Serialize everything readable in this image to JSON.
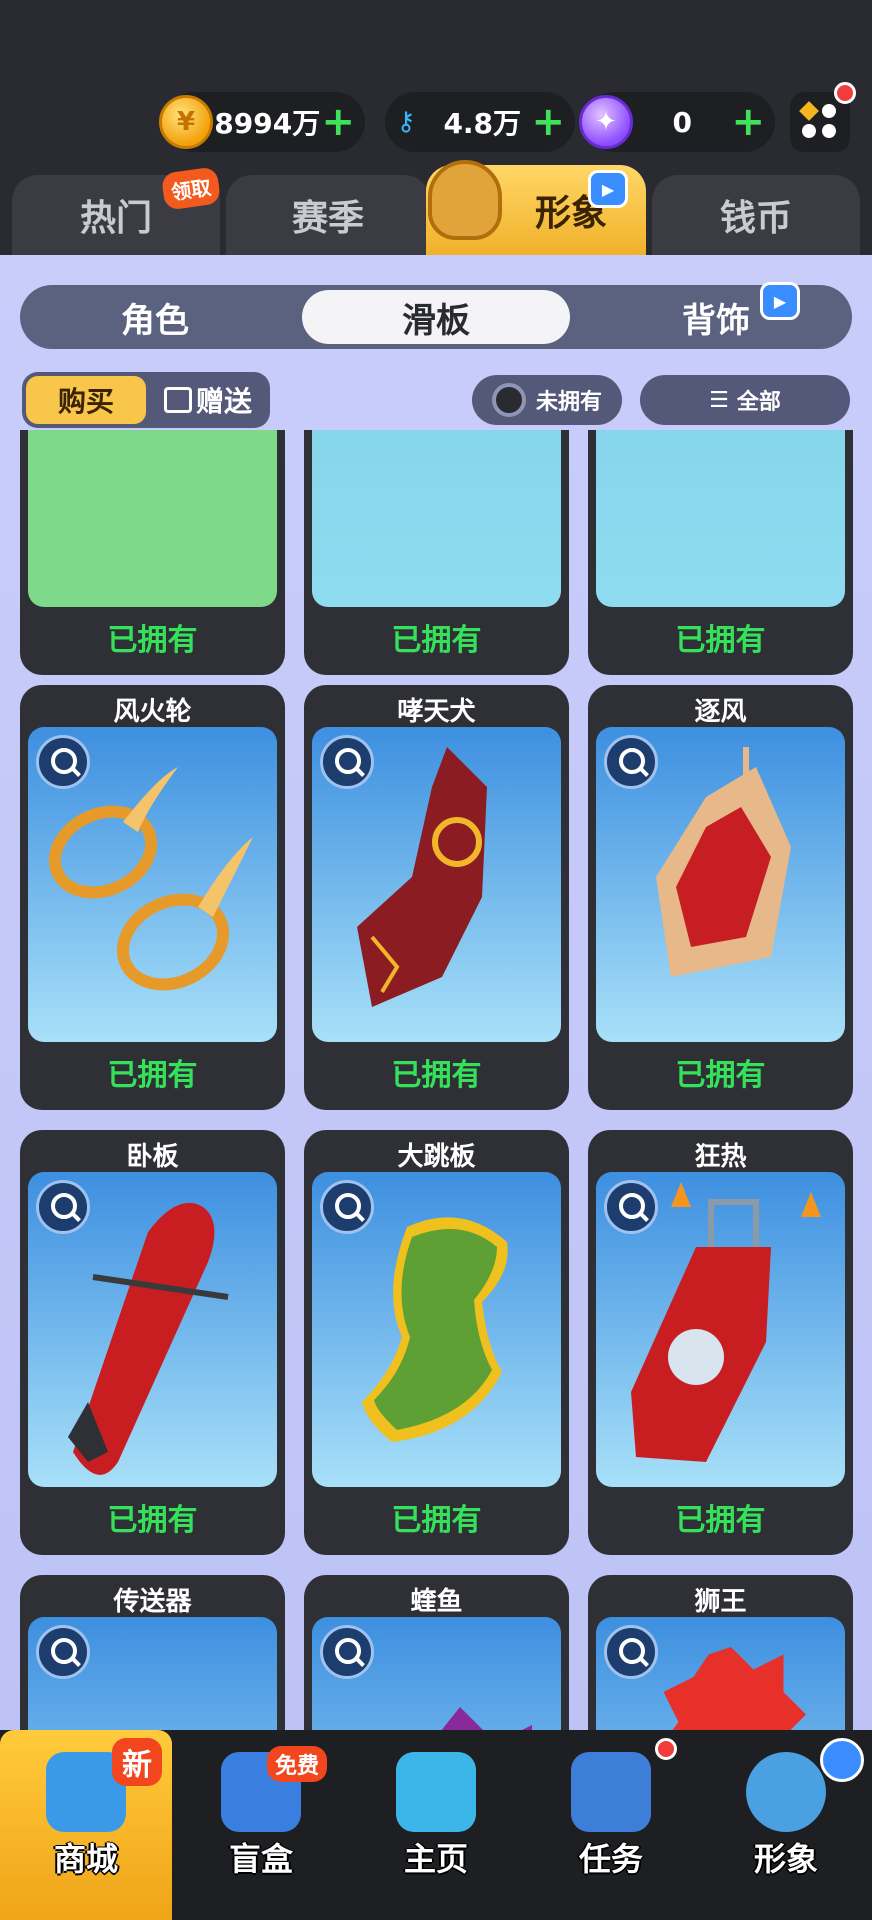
{
  "currencies": {
    "coins": {
      "icon": "coin-icon",
      "value": "8994万"
    },
    "keys": {
      "icon": "key-icon",
      "value": "4.8万"
    },
    "gems": {
      "icon": "gem-icon",
      "value": "0"
    },
    "plus_label": "+"
  },
  "tabs": [
    {
      "label": "热门",
      "badge": "领取"
    },
    {
      "label": "赛季"
    },
    {
      "label": "形象",
      "active": true
    },
    {
      "label": "钱币"
    }
  ],
  "subtabs": [
    {
      "label": "角色"
    },
    {
      "label": "滑板",
      "active": true
    },
    {
      "label": "背饰"
    }
  ],
  "toolbar": {
    "buy_label": "购买",
    "gift_label": "赠送",
    "filter_owned_label": "未拥有",
    "filter_all_label": "全部"
  },
  "cards": [
    {
      "name": "",
      "status": "已拥有"
    },
    {
      "name": "",
      "status": "已拥有"
    },
    {
      "name": "",
      "status": "已拥有"
    },
    {
      "name": "风火轮",
      "status": "已拥有"
    },
    {
      "name": "哮天犬",
      "status": "已拥有"
    },
    {
      "name": "逐风",
      "status": "已拥有"
    },
    {
      "name": "卧板",
      "status": "已拥有"
    },
    {
      "name": "大跳板",
      "status": "已拥有"
    },
    {
      "name": "狂热",
      "status": "已拥有"
    },
    {
      "name": "传送器",
      "status": ""
    },
    {
      "name": "蝰鱼",
      "status": ""
    },
    {
      "name": "狮王",
      "status": ""
    }
  ],
  "bottom_nav": [
    {
      "label": "商城",
      "badge": "新",
      "active": true
    },
    {
      "label": "盲盒",
      "badge": "免费"
    },
    {
      "label": "主页"
    },
    {
      "label": "任务"
    },
    {
      "label": "形象"
    }
  ],
  "colors": {
    "accent": "#f0b12a",
    "owned_green": "#35e05a",
    "background": "#2a2b30",
    "content_bg": "#c8cdfa"
  }
}
